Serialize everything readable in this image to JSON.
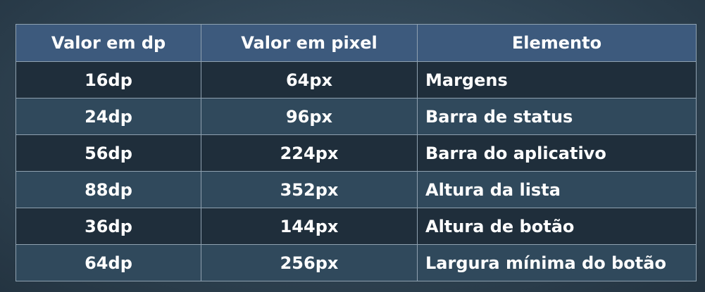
{
  "table": {
    "headers": [
      "Valor em dp",
      "Valor em pixel",
      "Elemento"
    ],
    "rows": [
      [
        "16dp",
        "64px",
        "Margens"
      ],
      [
        "24dp",
        "96px",
        "Barra de status"
      ],
      [
        "56dp",
        "224px",
        "Barra do aplicativo"
      ],
      [
        "88dp",
        "352px",
        "Altura da lista"
      ],
      [
        "36dp",
        "144px",
        "Altura de botão"
      ],
      [
        "64dp",
        "256px",
        "Largura mínima do botão"
      ]
    ]
  },
  "colors": {
    "background": "#2f4352",
    "header_fill": "#3d5a7d",
    "row_dark": "#1f2e3b",
    "row_light": "#30495c",
    "border": "#8fa1b0",
    "text": "#ffffff"
  }
}
